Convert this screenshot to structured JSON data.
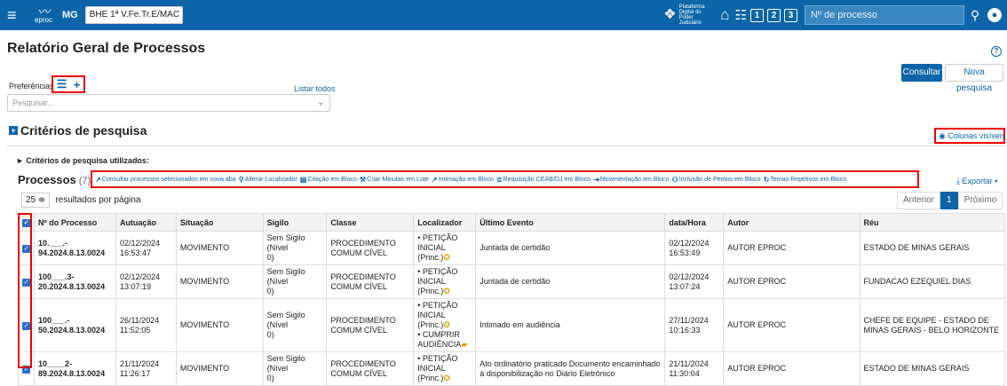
{
  "topbar": {
    "logo_text": "eproc",
    "uf": "MG",
    "unit_select": "BHE 1ª V.Fe.Tr.E/MAC ≑",
    "ppe_text": "Plataforma Digital do Poder Judiciário",
    "num_buttons": [
      "1",
      "2",
      "3"
    ],
    "search_placeholder": "Nº de processo"
  },
  "page": {
    "title": "Relatório Geral de Processos",
    "consultar": "Consultar",
    "nova_pesquisa": "Nova pesquisa",
    "preferencias": "Preferências",
    "listar_todos": "Listar todos",
    "pesquisar_placeholder": "Pesquisar...",
    "criterios_title": "Critérios de pesquisa",
    "colunas_visiveis": "Colunas visíveis",
    "criterios_utilizados": "► Critérios de pesquisa utilizados:",
    "processos_title": "Processos",
    "processos_count": "(7)",
    "exportar": "Exportar",
    "per_page_value": "25",
    "per_page_label": "resultados por página",
    "pager": {
      "prev": "Anterior",
      "current": "1",
      "next": "Próximo"
    }
  },
  "actions": [
    {
      "icon": "↗",
      "label": "Consultar processos selecionados em nova aba"
    },
    {
      "icon": "⚲",
      "label": "Alterar Localizador"
    },
    {
      "icon": "▤",
      "label": "Citação em Bloco"
    },
    {
      "icon": "⚒",
      "label": "Criar Minutas em Lote"
    },
    {
      "icon": "↗",
      "label": "Intimação em Bloco"
    },
    {
      "icon": "≣",
      "label": "Requisição CEAB/DJ em Bloco"
    },
    {
      "icon": "⇥",
      "label": "Movimentação em Bloco"
    },
    {
      "icon": "⚇",
      "label": "Inclusão de Peritos em Bloco"
    },
    {
      "icon": "↻",
      "label": "Temas Repetivos em Bloco"
    }
  ],
  "table": {
    "headers": [
      "Nº do Processo",
      "Autuação",
      "Situação",
      "Sigilo",
      "Classe",
      "Localizador",
      "Último Evento",
      "data/Hora",
      "Autor",
      "Réu"
    ],
    "rows": [
      {
        "proc1": "10.___.-",
        "proc2": "94.2024.8.13.0024",
        "aut1": "02/12/2024",
        "aut2": "16:53:47",
        "situacao": "MOVIMENTO",
        "sig1": "Sem Sigilo (Nível",
        "sig2": "0)",
        "cls1": "PROCEDIMENTO",
        "cls2": "COMUM CÍVEL",
        "loc": [
          "• PETIÇÃO INICIAL",
          "(Princ.)"
        ],
        "evento": [
          "Juntada de certidão"
        ],
        "dh1": "02/12/2024",
        "dh2": "16:53:49",
        "autor": "AUTOR EPROC",
        "reu": [
          "ESTADO DE MINAS GERAIS"
        ]
      },
      {
        "proc1": "100___.3-",
        "proc2": "20.2024.8.13.0024",
        "aut1": "02/12/2024",
        "aut2": "13:07:19",
        "situacao": "MOVIMENTO",
        "sig1": "Sem Sigilo (Nível",
        "sig2": "0)",
        "cls1": "PROCEDIMENTO",
        "cls2": "COMUM CÍVEL",
        "loc": [
          "• PETIÇÃO INICIAL",
          "(Princ.)"
        ],
        "evento": [
          "Juntada de certidão"
        ],
        "dh1": "02/12/2024",
        "dh2": "13:07:24",
        "autor": "AUTOR EPROC",
        "reu": [
          "FUNDACAO EZEQUIEL DIAS"
        ]
      },
      {
        "proc1": "100___.-",
        "proc2": "50.2024.8.13.0024",
        "aut1": "26/11/2024",
        "aut2": "11:52:05",
        "situacao": "MOVIMENTO",
        "sig1": "Sem Sigilo (Nível",
        "sig2": "0)",
        "cls1": "PROCEDIMENTO",
        "cls2": "COMUM CÍVEL",
        "loc": [
          "• PETIÇÃO INICIAL",
          "(Princ.)",
          "• CUMPRIR",
          "AUDIÊNCIA"
        ],
        "evento": [
          "Intimado em audiência"
        ],
        "dh1": "27/11/2024",
        "dh2": "10:16:33",
        "autor": "AUTOR EPROC",
        "reu": [
          "CHEFE DE EQUIPE - ESTADO DE",
          "MINAS GERAIS - BELO HORIZONTE"
        ]
      },
      {
        "proc1": "10____2-",
        "proc2": "89.2024.8.13.0024",
        "aut1": "21/11/2024",
        "aut2": "11:26:17",
        "situacao": "MOVIMENTO",
        "sig1": "Sem Sigilo (Nível",
        "sig2": "0)",
        "cls1": "PROCEDIMENTO",
        "cls2": "COMUM CÍVEL",
        "loc": [
          "• PETIÇÃO INICIAL",
          "(Princ.)"
        ],
        "evento": [
          "Ato ordinatório praticado Documento encaminhado",
          "à disponibilização no Diário Eletrônico"
        ],
        "dh1": "21/11/2024",
        "dh2": "11:30:04",
        "autor": "AUTOR EPROC",
        "reu": [
          "ESTADO DE MINAS GERAIS"
        ]
      }
    ]
  }
}
